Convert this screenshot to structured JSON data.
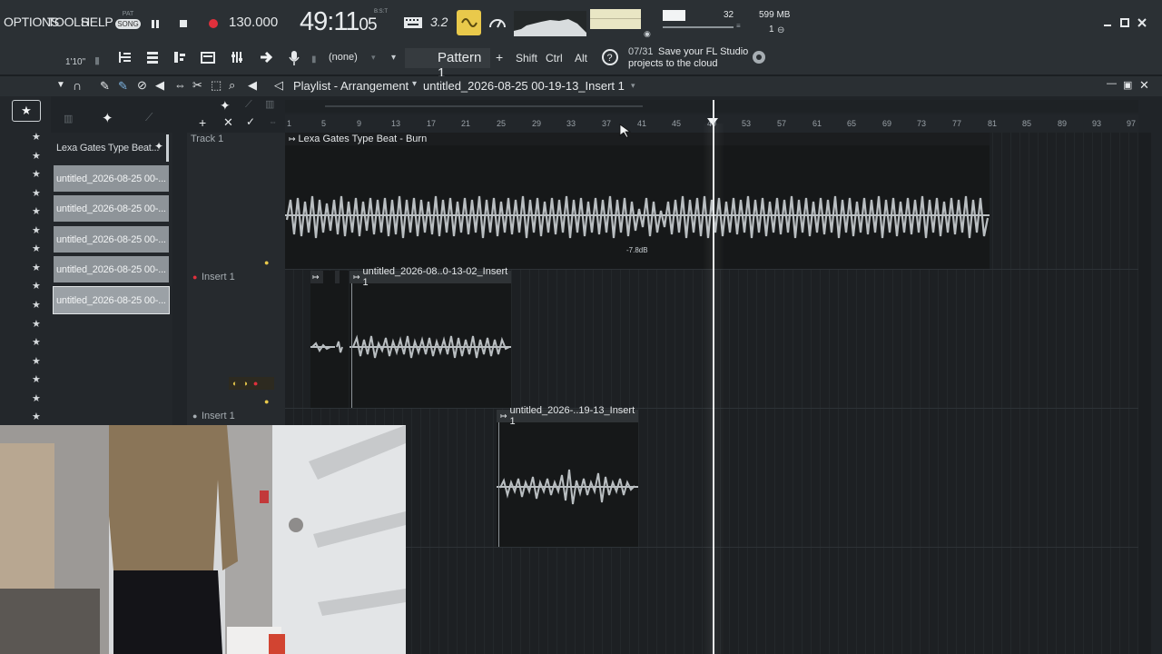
{
  "menu": {
    "options": "OPTIONS",
    "tools": "TOOLS",
    "help": "HELP"
  },
  "transport": {
    "mode_top": "PAT",
    "mode": "SONG",
    "tempo": "130.000",
    "time_main": "49:11",
    "time_sub": "05",
    "time_label": "B:S:T"
  },
  "indicators": {
    "pattern_steps": "3.2",
    "monitor_value": "32",
    "memory": "599 MB",
    "cpu_voices": "1"
  },
  "toolbar2": {
    "time_label": "1'10\"",
    "preset": "(none)",
    "pattern": "Pattern 1",
    "plus": "+",
    "shift": "Shift",
    "ctrl": "Ctrl",
    "alt": "Alt",
    "news_count": "07/31",
    "news_line1": "Save your FL Studio",
    "news_line2": "projects to the cloud"
  },
  "playlist": {
    "title": "Playlist - Arrangement",
    "separator": "›",
    "project": "untitled_2026-08-25 00-19-13_Insert 1"
  },
  "ruler": {
    "ticks": [
      "1",
      "5",
      "9",
      "13",
      "17",
      "21",
      "25",
      "29",
      "33",
      "37",
      "41",
      "45",
      "49",
      "53",
      "57",
      "61",
      "65",
      "69",
      "73",
      "77",
      "81",
      "85",
      "89",
      "93",
      "97"
    ]
  },
  "browser": {
    "header": "Lexa Gates Type Beat...",
    "items": [
      "untitled_2026-08-25 00-...",
      "untitled_2026-08-25 00-...",
      "untitled_2026-08-25 00-...",
      "untitled_2026-08-25 00-...",
      "untitled_2026-08-25 00-..."
    ]
  },
  "tracks": [
    {
      "label": "Track 1"
    },
    {
      "label": "Insert 1"
    },
    {
      "label": "Insert 1"
    }
  ],
  "clips": {
    "beat": "Lexa Gates Type Beat - Burn",
    "beat_db": "-7.8dB",
    "insert_a": "untitled_2026-08..0-13-02_Insert 1",
    "insert_b": "untitled_2026-..19-13_Insert 1"
  },
  "colors": {
    "bg": "#1b1f22",
    "toolbar": "#2b3034",
    "clip": "#141617",
    "wave": "#b9bec1",
    "accent_yellow": "#e9c94b",
    "record_red": "#e0303c"
  }
}
